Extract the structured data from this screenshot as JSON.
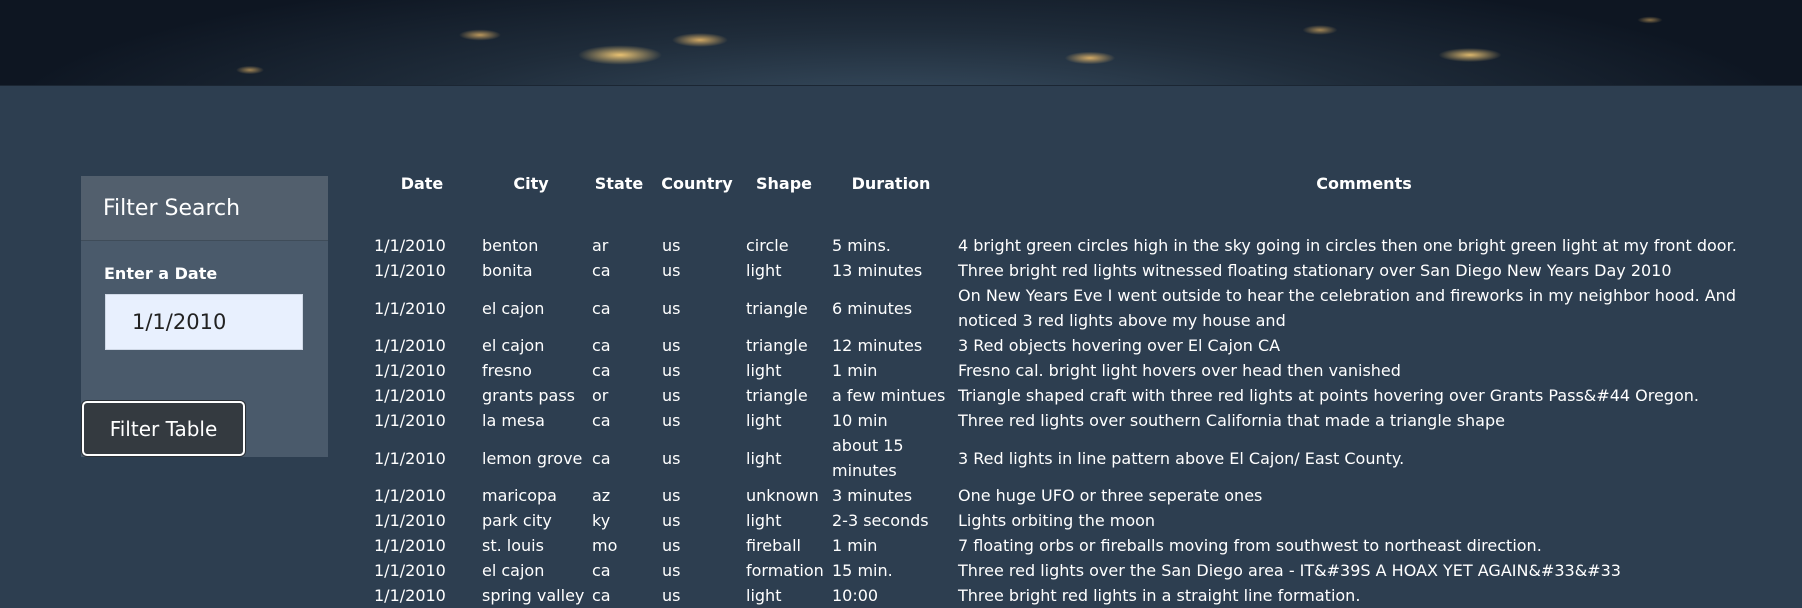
{
  "sidebar": {
    "title": "Filter Search",
    "date_label": "Enter a Date",
    "date_value": "1/1/2010",
    "button_label": "Filter Table"
  },
  "table": {
    "columns": [
      "Date",
      "City",
      "State",
      "Country",
      "Shape",
      "Duration",
      "Comments"
    ],
    "rows": [
      [
        "1/1/2010",
        "benton",
        "ar",
        "us",
        "circle",
        "5 mins.",
        "4 bright green circles high in the sky going in circles then one bright green light at my front door."
      ],
      [
        "1/1/2010",
        "bonita",
        "ca",
        "us",
        "light",
        "13 minutes",
        "Three bright red lights witnessed floating stationary over San Diego New Years Day 2010"
      ],
      [
        "1/1/2010",
        "el cajon",
        "ca",
        "us",
        "triangle",
        "6 minutes",
        "On New Years Eve I went outside to hear the celebration and fireworks in my neighbor hood. And noticed 3 red lights above my house and"
      ],
      [
        "1/1/2010",
        "el cajon",
        "ca",
        "us",
        "triangle",
        "12 minutes",
        "3 Red objects hovering over El Cajon CA"
      ],
      [
        "1/1/2010",
        "fresno",
        "ca",
        "us",
        "light",
        "1 min",
        "Fresno cal. bright light hovers over head then vanished"
      ],
      [
        "1/1/2010",
        "grants pass",
        "or",
        "us",
        "triangle",
        "a few mintues",
        "Triangle shaped craft with three red lights at points hovering over Grants Pass&#44 Oregon."
      ],
      [
        "1/1/2010",
        "la mesa",
        "ca",
        "us",
        "light",
        "10 min",
        "Three red lights over southern California that made a triangle shape"
      ],
      [
        "1/1/2010",
        "lemon grove",
        "ca",
        "us",
        "light",
        "about 15 minutes",
        "3 Red lights in line pattern above El Cajon/ East County."
      ],
      [
        "1/1/2010",
        "maricopa",
        "az",
        "us",
        "unknown",
        "3 minutes",
        "One huge UFO or three seperate ones"
      ],
      [
        "1/1/2010",
        "park city",
        "ky",
        "us",
        "light",
        "2-3 seconds",
        "Lights orbiting the moon"
      ],
      [
        "1/1/2010",
        "st. louis",
        "mo",
        "us",
        "fireball",
        "1 min",
        "7 floating orbs or fireballs moving from southwest to northeast direction."
      ],
      [
        "1/1/2010",
        "el cajon",
        "ca",
        "us",
        "formation",
        "15 min.",
        "Three red lights over the San Diego area - IT&#39S A HOAX YET AGAIN&#33&#33"
      ],
      [
        "1/1/2010",
        "spring valley",
        "ca",
        "us",
        "light",
        "10:00",
        "Three bright red lights in a straight line formation."
      ]
    ]
  }
}
